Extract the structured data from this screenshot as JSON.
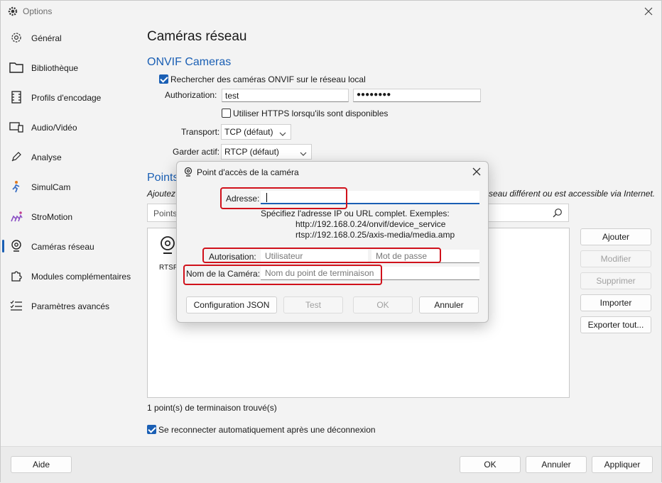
{
  "window": {
    "title": "Options",
    "close_icon": "close-icon"
  },
  "sidebar": {
    "items": [
      {
        "label": "Général",
        "icon": "gear-icon"
      },
      {
        "label": "Bibliothèque",
        "icon": "folder-icon"
      },
      {
        "label": "Profils d'encodage",
        "icon": "film-icon"
      },
      {
        "label": "Audio/Vidéo",
        "icon": "monitor-speaker-icon"
      },
      {
        "label": "Analyse",
        "icon": "pencil-icon"
      },
      {
        "label": "SimulCam",
        "icon": "runner-icon"
      },
      {
        "label": "StroMotion",
        "icon": "stromotion-icon"
      },
      {
        "label": "Caméras réseau",
        "icon": "webcam-icon"
      },
      {
        "label": "Modules complémentaires",
        "icon": "puzzle-icon"
      },
      {
        "label": "Paramètres avancés",
        "icon": "checklist-icon"
      }
    ],
    "active_index": 7
  },
  "main": {
    "title": "Caméras réseau",
    "onvif": {
      "section_title": "ONVIF Cameras",
      "search_checkbox_label": "Rechercher des caméras ONVIF sur le réseau local",
      "search_checked": true,
      "authorization_label": "Authorization:",
      "username_value": "test",
      "password_value": "●●●●●●●●",
      "https_checkbox_label": "Utiliser HTTPS lorsqu'ils sont disponibles",
      "https_checked": false,
      "transport_label": "Transport:",
      "transport_value": "TCP (défaut)",
      "keepalive_label": "Garder actif:",
      "keepalive_value": "RTCP (défaut)"
    },
    "endpoints": {
      "section_title_partial": "Points",
      "note_left": "Ajoutez",
      "note_right": "seau différent ou est accessible via Internet.",
      "search_placeholder": "Points",
      "item_label": "RTSP",
      "count_text": "1 point(s) de terminaison trouvé(s)",
      "buttons": {
        "add": "Ajouter",
        "edit": "Modifier",
        "delete": "Supprimer",
        "import": "Importer",
        "export": "Exporter tout..."
      }
    },
    "reconnect_label": "Se reconnecter automatiquement après une déconnexion",
    "reconnect_checked": true
  },
  "footer": {
    "help": "Aide",
    "ok": "OK",
    "cancel": "Annuler",
    "apply": "Appliquer"
  },
  "dialog": {
    "title": "Point d'accès de la caméra",
    "address_label": "Adresse:",
    "address_value": "",
    "hint_line1": "Spécifiez l'adresse IP ou URL complet. Exemples:",
    "hint_line2": "http://192.168.0.24/onvif/device_service",
    "hint_line3": "rtsp://192.168.0.25/axis-media/media.amp",
    "auth_label": "Autorisation:",
    "user_placeholder": "Utilisateur",
    "pass_placeholder": "Mot de passe",
    "name_label": "Nom de la Caméra:",
    "name_placeholder": "Nom du point de terminaison",
    "btn_json": "Configuration JSON",
    "btn_test": "Test",
    "btn_ok": "OK",
    "btn_cancel": "Annuler",
    "highlight_color": "#d0111b"
  },
  "colors": {
    "accent": "#1a5fb4",
    "highlight": "#d0111b"
  }
}
